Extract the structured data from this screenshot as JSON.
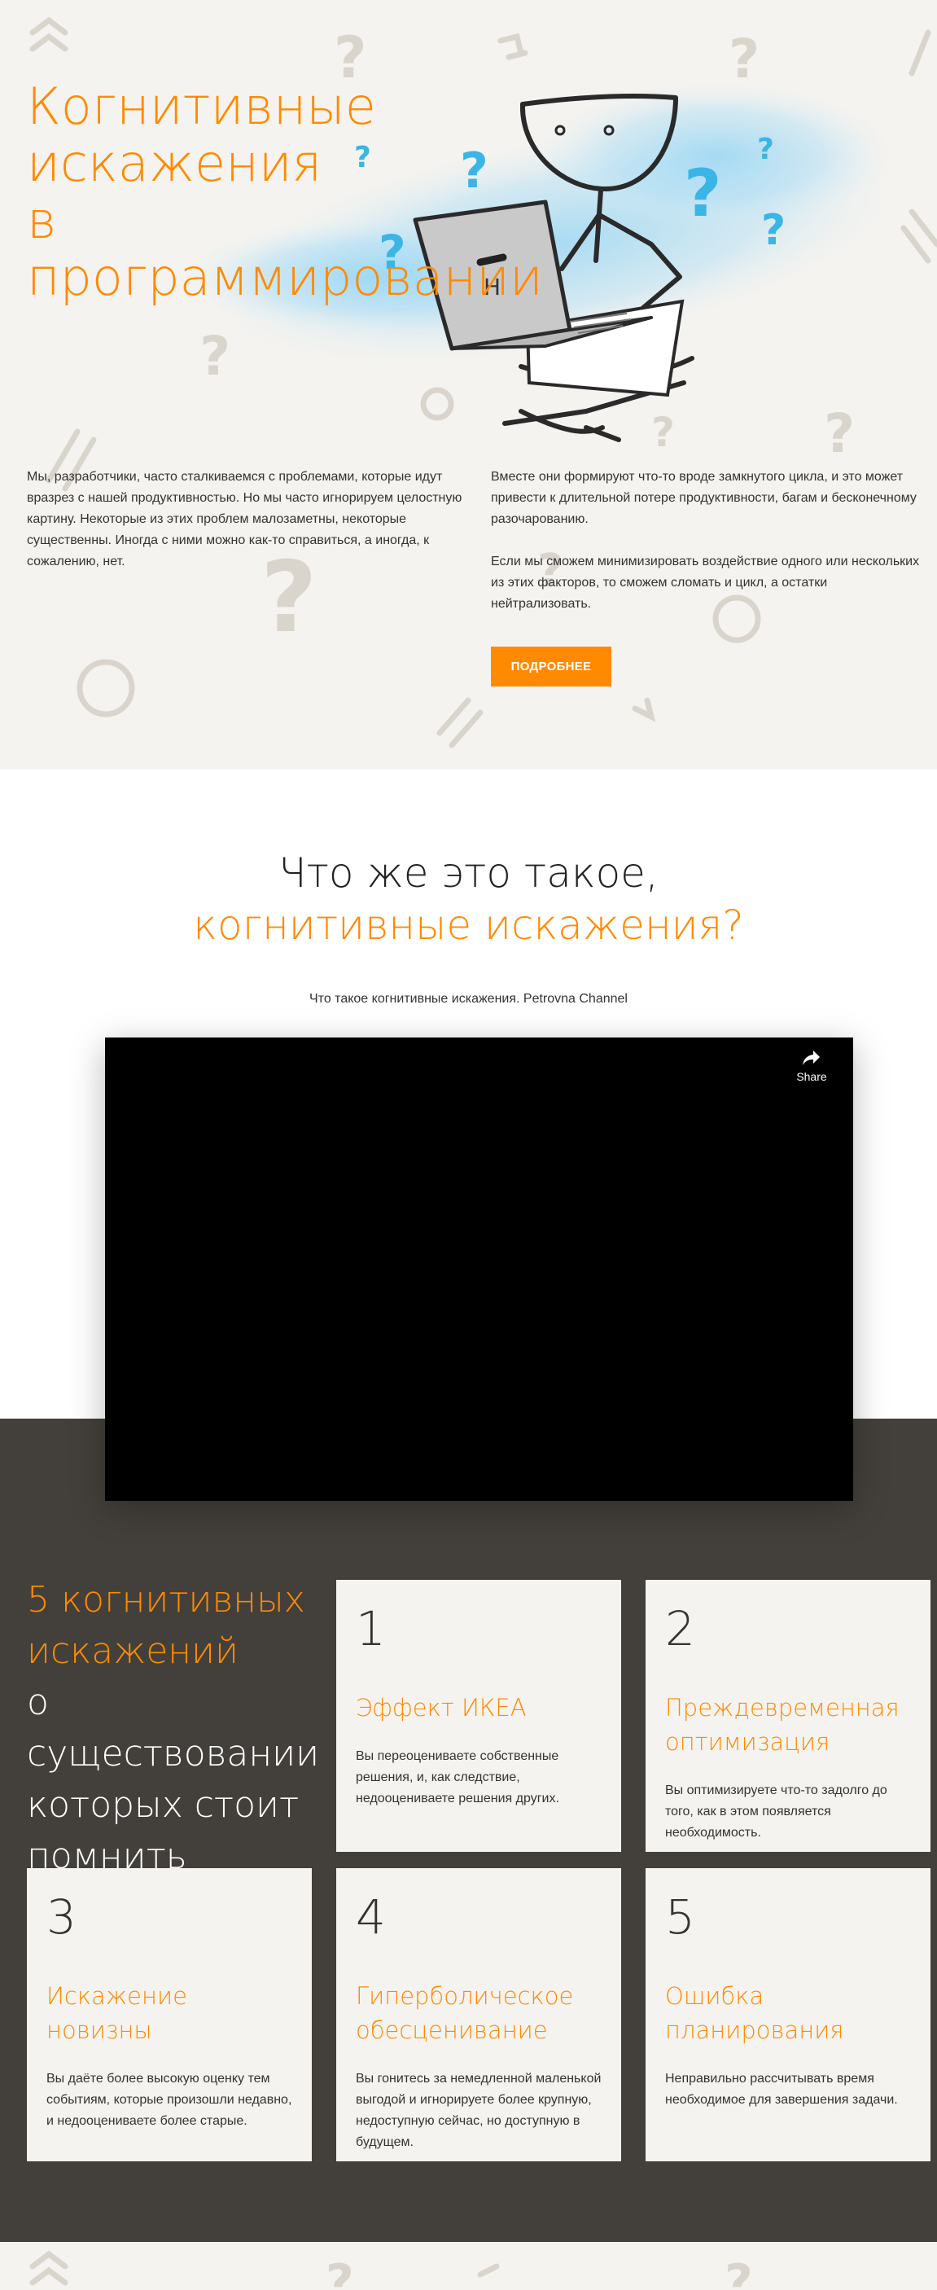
{
  "hero": {
    "title_lines": [
      "Когнитивные",
      "искажения",
      "в программировании"
    ],
    "paragraph_left": "Мы, разработчики, часто сталкиваемся с проблемами, которые идут вразрез с нашей продуктивностью. Но мы часто игнорируем целостную картину. Некоторые из этих проблем малозаметны, некоторые существенны. Иногда с ними можно как-то справиться, а иногда, к сожалению, нет.",
    "paragraph_right_1": "Вместе они формируют что-то вроде замкнутого цикла, и это может привести к длительной потере продуктивности, багам и бесконечному разочарованию.",
    "paragraph_right_2": "Если мы сможем минимизировать воздействие одного или нескольких из этих факторов, то сможем сломать и цикл, а остатки нейтрализовать.",
    "cta_label": "ПОДРОБНЕЕ",
    "laptop_logo": "H"
  },
  "video_section": {
    "title_line1": "Что же это такое,",
    "title_line2": "когнитивные искажения?",
    "caption": "Что такое когнитивные искажения. Petrovna Channel",
    "share_label": "Share"
  },
  "biases_section": {
    "heading_orange": [
      "5 когнитивных",
      "искажений"
    ],
    "heading_white": [
      "о существовании",
      "которых стоит",
      "помнить"
    ],
    "cards": [
      {
        "number": "1",
        "title": "Эффект ИКЕА",
        "text": "Вы переоцениваете собственные решения, и, как следствие, недооцениваете решения других."
      },
      {
        "number": "2",
        "title": "Преждевременная оптимизация",
        "text": "Вы оптимизируете что-то задолго до того, как в этом появляется необходимость."
      },
      {
        "number": "3",
        "title": "Искажение новизны",
        "text": "Вы даёте более высокую оценку тем событиям, которые произошли недавно, и недооцениваете более старые."
      },
      {
        "number": "4",
        "title": "Гиперболическое обесценивание",
        "text": "Вы гонитесь за немедленной маленькой выгодой и игнорируете более крупную, недоступную сейчас, но доступную в будущем."
      },
      {
        "number": "5",
        "title": "Ошибка планирования",
        "text": "Неправильно рассчитывать время необходимое для завершения задачи."
      }
    ]
  },
  "colors": {
    "accent": "#ff8a00",
    "hero_bg": "#f5f3ef",
    "dark_bg": "#43403b",
    "question_marks": "#3bb4e6"
  }
}
